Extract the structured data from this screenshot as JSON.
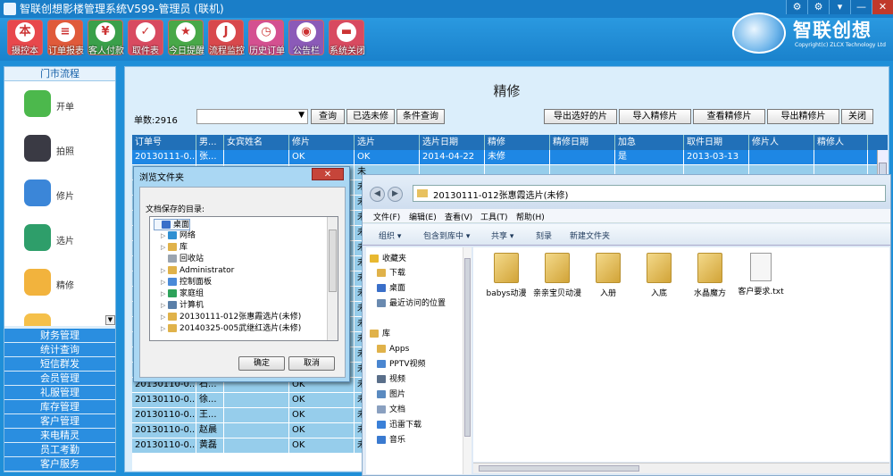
{
  "window": {
    "title": "智联创想影楼管理系统V599-管理员 (联机)",
    "controls": [
      "⚙",
      "⚙",
      "▾",
      "—",
      "✕"
    ]
  },
  "toolbar": [
    {
      "label": "摄控本",
      "icon": "book-icon",
      "glyph": "本"
    },
    {
      "label": "订单报表",
      "icon": "report-icon",
      "glyph": "≡"
    },
    {
      "label": "客人付款",
      "icon": "payment-icon",
      "glyph": "¥"
    },
    {
      "label": "取件表",
      "icon": "pickup-icon",
      "glyph": "✓"
    },
    {
      "label": "今日提醒",
      "icon": "reminder-icon",
      "glyph": "★"
    },
    {
      "label": "流程监控",
      "icon": "monitor-icon",
      "glyph": "J"
    },
    {
      "label": "历史订单",
      "icon": "history-icon",
      "glyph": "◷"
    },
    {
      "label": "公告栏",
      "icon": "notice-icon",
      "glyph": "◉"
    },
    {
      "label": "系统关闭",
      "icon": "shutdown-icon",
      "glyph": "▬"
    }
  ],
  "brand": {
    "name": "智联创想",
    "sub": "Copyright(c) ZLCX Technology Ltd"
  },
  "sidebar": {
    "header": "门市流程",
    "flow": [
      {
        "label": "开单",
        "icon": "phone-icon",
        "color": "#4cb84c"
      },
      {
        "label": "拍照",
        "icon": "camera-icon",
        "color": "#3a3a44"
      },
      {
        "label": "修片",
        "icon": "edit-photo-icon",
        "color": "#3b86d8"
      },
      {
        "label": "选片",
        "icon": "select-photo-icon",
        "color": "#2e9e6a"
      },
      {
        "label": "精修",
        "icon": "retouch-icon",
        "color": "#f2b33d"
      },
      {
        "label": "",
        "icon": "more-icon",
        "color": "#f5c04a"
      }
    ],
    "menu": [
      "财务管理",
      "统计查询",
      "短信群发",
      "会员管理",
      "礼服管理",
      "库存管理",
      "客户管理",
      "来电精灵",
      "员工考勤",
      "客户服务"
    ]
  },
  "main": {
    "title": "精修",
    "count_label": "单数:2916",
    "select_value": "",
    "buttons_left": [
      "查询",
      "已选未修",
      "条件查询"
    ],
    "buttons_right": [
      "导出选好的片",
      "导入精修片",
      "查看精修片",
      "导出精修片",
      "关闭"
    ],
    "columns": [
      "订单号",
      "男...",
      "女宾姓名",
      "修片",
      "选片",
      "选片日期",
      "精修",
      "精修日期",
      "加急",
      "取件日期",
      "修片人",
      "精修人"
    ],
    "rows": [
      [
        "20130111-0...",
        "张...",
        "",
        "OK",
        "OK",
        "2014-04-22",
        "未修",
        "",
        "是",
        "2013-03-13",
        "",
        ""
      ],
      [
        "",
        "",
        "",
        "",
        "未",
        "",
        "",
        "",
        "",
        "",
        "",
        ""
      ],
      [
        "",
        "",
        "",
        "",
        "未",
        "",
        "",
        "",
        "",
        "",
        "",
        ""
      ],
      [
        "",
        "",
        "",
        "",
        "未",
        "",
        "",
        "",
        "",
        "",
        "",
        ""
      ],
      [
        "",
        "",
        "",
        "",
        "未",
        "",
        "",
        "",
        "",
        "",
        "",
        ""
      ],
      [
        "",
        "",
        "",
        "",
        "未",
        "",
        "",
        "",
        "",
        "",
        "",
        ""
      ],
      [
        "",
        "",
        "",
        "",
        "未",
        "",
        "",
        "",
        "",
        "",
        "",
        ""
      ],
      [
        "",
        "",
        "",
        "",
        "未",
        "",
        "",
        "",
        "",
        "",
        "",
        ""
      ],
      [
        "",
        "",
        "",
        "",
        "未",
        "",
        "",
        "",
        "",
        "",
        "",
        ""
      ],
      [
        "",
        "",
        "",
        "",
        "未",
        "",
        "",
        "",
        "",
        "",
        "",
        ""
      ],
      [
        "",
        "",
        "",
        "",
        "未",
        "",
        "",
        "",
        "",
        "",
        "",
        ""
      ],
      [
        "",
        "",
        "",
        "",
        "未",
        "",
        "",
        "",
        "",
        "",
        "",
        ""
      ],
      [
        "",
        "",
        "",
        "",
        "未",
        "",
        "",
        "",
        "",
        "",
        "",
        ""
      ],
      [
        "",
        "",
        "",
        "",
        "未",
        "",
        "",
        "",
        "",
        "",
        "",
        ""
      ],
      [
        "",
        "",
        "",
        "",
        "未",
        "",
        "",
        "",
        "",
        "",
        "",
        ""
      ],
      [
        "20130110-0...",
        "石...",
        "",
        "OK",
        "未",
        "",
        "",
        "",
        "",
        "",
        "",
        ""
      ],
      [
        "20130110-0...",
        "徐...",
        "",
        "OK",
        "未",
        "",
        "",
        "",
        "",
        "",
        "",
        ""
      ],
      [
        "20130110-0...",
        "王...",
        "",
        "OK",
        "未",
        "",
        "",
        "",
        "",
        "",
        "",
        ""
      ],
      [
        "20130110-0...",
        "赵晨",
        "",
        "OK",
        "未",
        "",
        "",
        "",
        "",
        "",
        "",
        ""
      ],
      [
        "20130110-0...",
        "黄磊",
        "",
        "OK",
        "未",
        "",
        "",
        "",
        "",
        "",
        "",
        ""
      ]
    ]
  },
  "dialog": {
    "title": "浏览文件夹",
    "close": "✕",
    "label": "文档保存的目录:",
    "tree": [
      {
        "label": "桌面",
        "level": 0,
        "expander": "",
        "color": "#3a6fc9",
        "selected": true
      },
      {
        "label": "网络",
        "level": 1,
        "expander": "▷",
        "color": "#2f8fd2"
      },
      {
        "label": "库",
        "level": 1,
        "expander": "▷",
        "color": "#e0b24a"
      },
      {
        "label": "回收站",
        "level": 1,
        "expander": "",
        "color": "#9aa4b0"
      },
      {
        "label": "Administrator",
        "level": 1,
        "expander": "▷",
        "color": "#e0b24a"
      },
      {
        "label": "控制面板",
        "level": 1,
        "expander": "▷",
        "color": "#4a8ad8"
      },
      {
        "label": "家庭组",
        "level": 1,
        "expander": "▷",
        "color": "#2ea25a"
      },
      {
        "label": "计算机",
        "level": 1,
        "expander": "▷",
        "color": "#5a7fa8"
      },
      {
        "label": "20130111-012张惠霞选片(未修)",
        "level": 1,
        "expander": "▷",
        "color": "#e0b24a"
      },
      {
        "label": "20140325-005武继红选片(未修)",
        "level": 1,
        "expander": "▷",
        "color": "#e0b24a"
      }
    ],
    "ok": "确定",
    "cancel": "取消"
  },
  "explorer": {
    "address": "20130111-012张惠霞选片(未修)",
    "menu": [
      "文件(F)",
      "编辑(E)",
      "查看(V)",
      "工具(T)",
      "帮助(H)"
    ],
    "commands": [
      "组织 ▾",
      "包含到库中 ▾",
      "共享 ▾",
      "刻录",
      "新建文件夹"
    ],
    "nav": [
      {
        "label": "收藏夹",
        "color": "#e8b830",
        "indent": 0
      },
      {
        "label": "下载",
        "color": "#e0b24a",
        "indent": 1
      },
      {
        "label": "桌面",
        "color": "#3a6fc9",
        "indent": 1
      },
      {
        "label": "最近访问的位置",
        "color": "#6a8ab0",
        "indent": 1
      },
      {
        "label": "库",
        "color": "#e0b24a",
        "indent": 0
      },
      {
        "label": "Apps",
        "color": "#e0b24a",
        "indent": 1
      },
      {
        "label": "PPTV视频",
        "color": "#4a86d0",
        "indent": 1
      },
      {
        "label": "视频",
        "color": "#5a6f8a",
        "indent": 1
      },
      {
        "label": "图片",
        "color": "#5a8ac0",
        "indent": 1
      },
      {
        "label": "文档",
        "color": "#8aa0c0",
        "indent": 1
      },
      {
        "label": "迅雷下载",
        "color": "#3a80d8",
        "indent": 1
      },
      {
        "label": "音乐",
        "color": "#3a7ad0",
        "indent": 1
      }
    ],
    "files": [
      {
        "name": "babys动漫",
        "type": "folder"
      },
      {
        "name": "亲亲宝贝动漫",
        "type": "folder"
      },
      {
        "name": "入册",
        "type": "folder"
      },
      {
        "name": "入底",
        "type": "folder"
      },
      {
        "name": "水晶魔方",
        "type": "folder"
      },
      {
        "name": "客户要求.txt",
        "type": "document"
      }
    ]
  }
}
